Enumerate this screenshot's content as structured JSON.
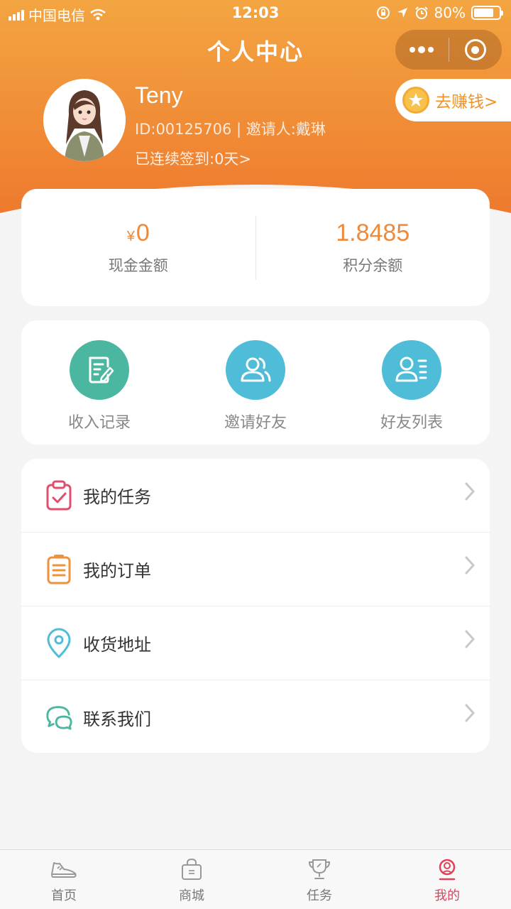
{
  "status_bar": {
    "carrier": "中国电信",
    "time": "12:03",
    "battery": "80%"
  },
  "nav": {
    "title": "个人中心"
  },
  "user": {
    "name": "Teny",
    "id_line": "ID:00125706 | 邀请人:戴琳",
    "sign_in": "已连续签到:0天>"
  },
  "earn": {
    "label": "去赚钱>"
  },
  "balances": [
    {
      "currency": "¥",
      "value": "0",
      "label": "现金金额"
    },
    {
      "value": "1.8485",
      "label": "积分余额"
    }
  ],
  "quick_actions": [
    {
      "label": "收入记录",
      "icon": "edit-note-icon",
      "color": "#4cb7a0"
    },
    {
      "label": "邀请好友",
      "icon": "friends-icon",
      "color": "#4fbcd8"
    },
    {
      "label": "好友列表",
      "icon": "friend-list-icon",
      "color": "#4fbcd8"
    }
  ],
  "menu": [
    {
      "label": "我的任务",
      "icon": "clipboard-check-icon",
      "color": "#e24d6b"
    },
    {
      "label": "我的订单",
      "icon": "order-list-icon",
      "color": "#f0923a"
    },
    {
      "label": "收货地址",
      "icon": "location-pin-icon",
      "color": "#4fbcd8"
    },
    {
      "label": "联系我们",
      "icon": "chat-bubbles-icon",
      "color": "#4cb7a0"
    }
  ],
  "tabs": [
    {
      "label": "首页",
      "icon": "shoe-icon",
      "active": false
    },
    {
      "label": "商城",
      "icon": "shopping-bag-icon",
      "active": false
    },
    {
      "label": "任务",
      "icon": "trophy-icon",
      "active": false
    },
    {
      "label": "我的",
      "icon": "user-icon",
      "active": true
    }
  ],
  "colors": {
    "header_top": "#f3a541",
    "header_bottom": "#ee7a2e",
    "accent": "#ee8a3a",
    "active_tab": "#e0425a"
  }
}
